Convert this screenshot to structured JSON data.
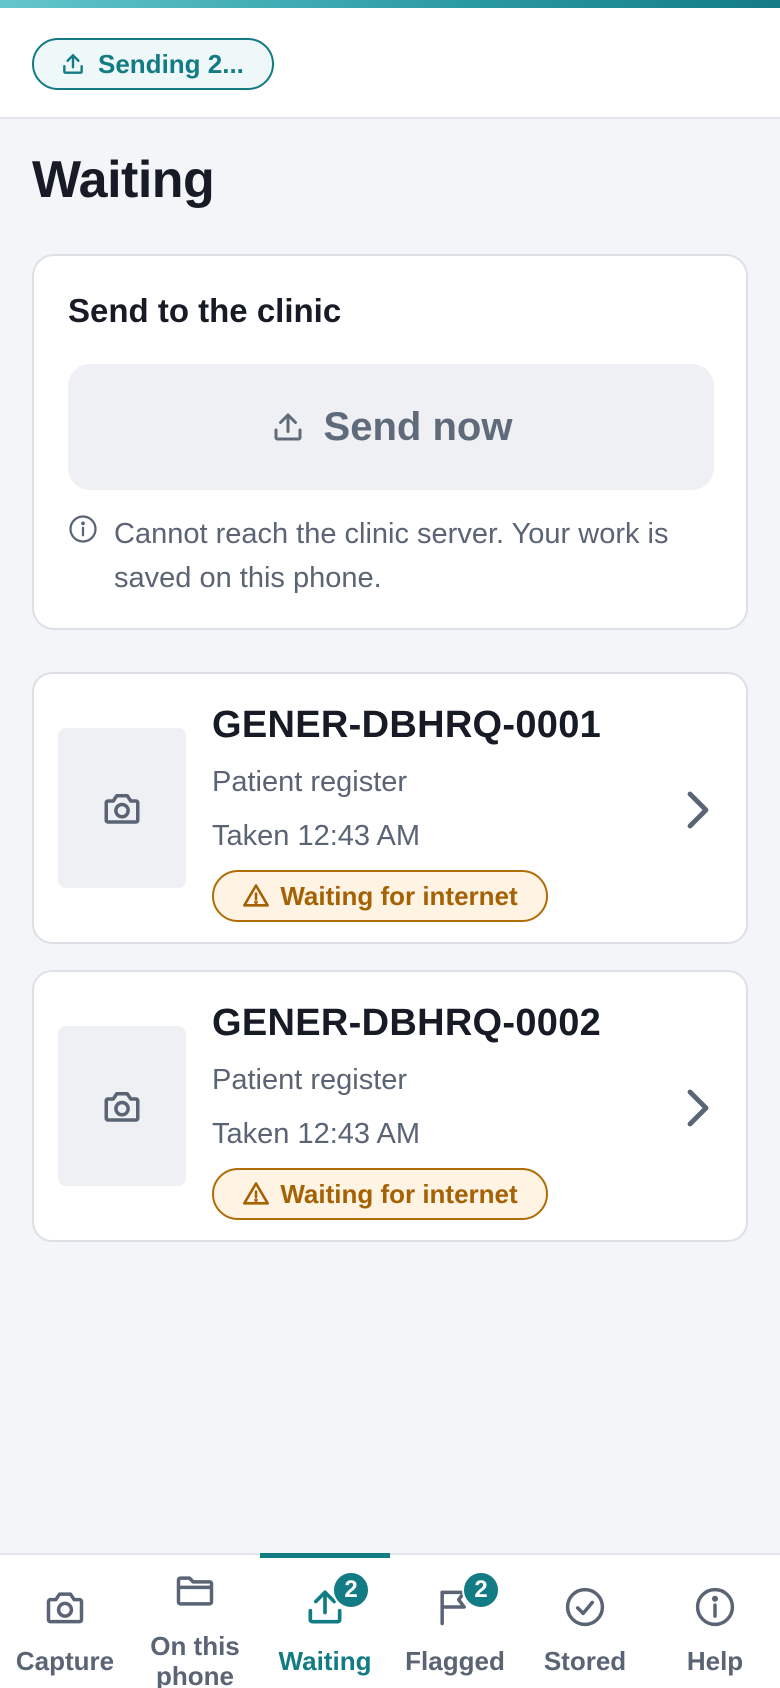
{
  "header": {
    "sync_status": "Sending 2..."
  },
  "page": {
    "title": "Waiting"
  },
  "send_card": {
    "title": "Send to the clinic",
    "button_label": "Send now",
    "info_message": "Cannot reach the clinic server. Your work is saved on this phone."
  },
  "documents": [
    {
      "id": "GENER-DBHRQ-0001",
      "type": "Patient register",
      "taken": "Taken 12:43 AM",
      "status": "Waiting for internet"
    },
    {
      "id": "GENER-DBHRQ-0002",
      "type": "Patient register",
      "taken": "Taken 12:43 AM",
      "status": "Waiting for internet"
    }
  ],
  "nav": {
    "items": [
      {
        "label": "Capture",
        "icon": "camera-icon"
      },
      {
        "label": "On this phone",
        "icon": "folder-icon"
      },
      {
        "label": "Waiting",
        "icon": "upload-icon",
        "badge": "2",
        "active": true
      },
      {
        "label": "Flagged",
        "icon": "flag-icon",
        "badge": "2"
      },
      {
        "label": "Stored",
        "icon": "check-circle-icon"
      },
      {
        "label": "Help",
        "icon": "info-icon"
      }
    ]
  },
  "colors": {
    "accent": "#137b83",
    "warning": "#a46205",
    "warning_bg": "#fff4e3",
    "background": "#f4f5f8"
  }
}
